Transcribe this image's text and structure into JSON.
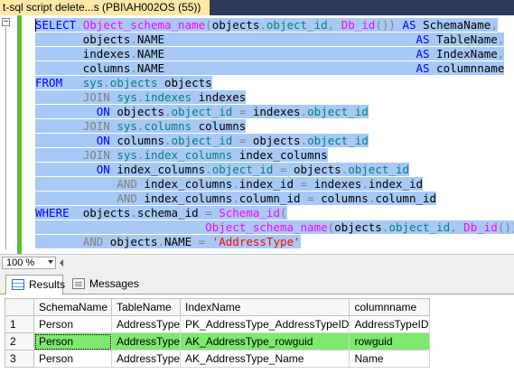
{
  "document_tab": {
    "title": "t-sql script delete...s (PBI\\AH002OS (55))"
  },
  "editor": {
    "lines": [
      [
        [
          "kw",
          "SELECT"
        ],
        [
          "tx",
          " "
        ],
        [
          "fn",
          "Object_schema_name"
        ],
        [
          "op",
          "("
        ],
        [
          "tx",
          "objects"
        ],
        [
          "op",
          "."
        ],
        [
          "id",
          "object_id"
        ],
        [
          "op",
          ", "
        ],
        [
          "fn",
          "Db_id"
        ],
        [
          "op",
          "())"
        ],
        [
          "tx",
          " "
        ],
        [
          "kw",
          "AS"
        ],
        [
          "tx",
          " SchemaName"
        ],
        [
          "op",
          ","
        ]
      ],
      [
        [
          "tx",
          "       objects"
        ],
        [
          "op",
          "."
        ],
        [
          "tx",
          "NAME                                     "
        ],
        [
          "kw",
          "AS"
        ],
        [
          "tx",
          " TableName"
        ],
        [
          "op",
          ","
        ]
      ],
      [
        [
          "tx",
          "       indexes"
        ],
        [
          "op",
          "."
        ],
        [
          "tx",
          "NAME                                     "
        ],
        [
          "kw",
          "AS"
        ],
        [
          "tx",
          " IndexName"
        ],
        [
          "op",
          ","
        ]
      ],
      [
        [
          "tx",
          "       columns"
        ],
        [
          "op",
          "."
        ],
        [
          "tx",
          "NAME                                     "
        ],
        [
          "kw",
          "AS"
        ],
        [
          "tx",
          " columnname"
        ]
      ],
      [
        [
          "kw",
          "FROM"
        ],
        [
          "tx",
          "   "
        ],
        [
          "id",
          "sys"
        ],
        [
          "op",
          "."
        ],
        [
          "id",
          "objects"
        ],
        [
          "tx",
          " objects"
        ]
      ],
      [
        [
          "tx",
          "       "
        ],
        [
          "op",
          "JOIN"
        ],
        [
          "tx",
          " "
        ],
        [
          "id",
          "sys"
        ],
        [
          "op",
          "."
        ],
        [
          "id",
          "indexes"
        ],
        [
          "tx",
          " indexes"
        ]
      ],
      [
        [
          "tx",
          "         "
        ],
        [
          "kw",
          "ON"
        ],
        [
          "tx",
          " objects"
        ],
        [
          "op",
          "."
        ],
        [
          "id",
          "object_id"
        ],
        [
          "tx",
          " "
        ],
        [
          "op",
          "="
        ],
        [
          "tx",
          " indexes"
        ],
        [
          "op",
          "."
        ],
        [
          "id",
          "object_id"
        ]
      ],
      [
        [
          "tx",
          "       "
        ],
        [
          "op",
          "JOIN"
        ],
        [
          "tx",
          " "
        ],
        [
          "id",
          "sys"
        ],
        [
          "op",
          "."
        ],
        [
          "id",
          "columns"
        ],
        [
          "tx",
          " columns"
        ]
      ],
      [
        [
          "tx",
          "         "
        ],
        [
          "kw",
          "ON"
        ],
        [
          "tx",
          " columns"
        ],
        [
          "op",
          "."
        ],
        [
          "id",
          "object_id"
        ],
        [
          "tx",
          " "
        ],
        [
          "op",
          "="
        ],
        [
          "tx",
          " objects"
        ],
        [
          "op",
          "."
        ],
        [
          "id",
          "object_id"
        ]
      ],
      [
        [
          "tx",
          "       "
        ],
        [
          "op",
          "JOIN"
        ],
        [
          "tx",
          " "
        ],
        [
          "id",
          "sys"
        ],
        [
          "op",
          "."
        ],
        [
          "id",
          "index_columns"
        ],
        [
          "tx",
          " index_columns"
        ]
      ],
      [
        [
          "tx",
          "         "
        ],
        [
          "kw",
          "ON"
        ],
        [
          "tx",
          " index_columns"
        ],
        [
          "op",
          "."
        ],
        [
          "id",
          "object_id"
        ],
        [
          "tx",
          " "
        ],
        [
          "op",
          "="
        ],
        [
          "tx",
          " objects"
        ],
        [
          "op",
          "."
        ],
        [
          "id",
          "object_id"
        ]
      ],
      [
        [
          "tx",
          "            "
        ],
        [
          "op",
          "AND"
        ],
        [
          "tx",
          " index_columns"
        ],
        [
          "op",
          "."
        ],
        [
          "tx",
          "index_id"
        ],
        [
          "tx",
          " "
        ],
        [
          "op",
          "="
        ],
        [
          "tx",
          " indexes"
        ],
        [
          "op",
          "."
        ],
        [
          "tx",
          "index_id"
        ]
      ],
      [
        [
          "tx",
          "            "
        ],
        [
          "op",
          "AND"
        ],
        [
          "tx",
          " index_columns"
        ],
        [
          "op",
          "."
        ],
        [
          "tx",
          "column_id"
        ],
        [
          "tx",
          " "
        ],
        [
          "op",
          "="
        ],
        [
          "tx",
          " columns"
        ],
        [
          "op",
          "."
        ],
        [
          "tx",
          "column_id"
        ]
      ],
      [
        [
          "kw",
          "WHERE"
        ],
        [
          "tx",
          "  objects"
        ],
        [
          "op",
          "."
        ],
        [
          "tx",
          "schema_id"
        ],
        [
          "tx",
          " "
        ],
        [
          "op",
          "="
        ],
        [
          "tx",
          " "
        ],
        [
          "fn",
          "Schema_id"
        ],
        [
          "op",
          "("
        ]
      ],
      [
        [
          "tx",
          "                         "
        ],
        [
          "fn",
          "Object_schema_name"
        ],
        [
          "op",
          "("
        ],
        [
          "tx",
          "objects"
        ],
        [
          "op",
          "."
        ],
        [
          "id",
          "object_id"
        ],
        [
          "op",
          ", "
        ],
        [
          "fn",
          "Db_id"
        ],
        [
          "op",
          "()))"
        ]
      ],
      [
        [
          "tx",
          "       "
        ],
        [
          "op",
          "AND"
        ],
        [
          "tx",
          " objects"
        ],
        [
          "op",
          "."
        ],
        [
          "tx",
          "NAME"
        ],
        [
          "tx",
          " "
        ],
        [
          "op",
          "="
        ],
        [
          "tx",
          " "
        ],
        [
          "str",
          "'AddressType'"
        ]
      ]
    ]
  },
  "status": {
    "zoom": "100 %"
  },
  "results_tabs": {
    "results_label": "Results",
    "messages_label": "Messages"
  },
  "grid": {
    "columns": [
      "SchemaName",
      "TableName",
      "IndexName",
      "columnname"
    ],
    "rows": [
      {
        "num": "1",
        "cells": [
          "Person",
          "AddressType",
          "PK_AddressType_AddressTypeID",
          "AddressTypeID"
        ]
      },
      {
        "num": "2",
        "cells": [
          "Person",
          "AddressType",
          "AK_AddressType_rowguid",
          "rowguid"
        ]
      },
      {
        "num": "3",
        "cells": [
          "Person",
          "AddressType",
          "AK_AddressType_Name",
          "Name"
        ]
      }
    ],
    "selected_row": 2,
    "selected_color": "#7ee86f"
  },
  "colors": {
    "tab_strip": "#2b3c59",
    "active_tab": "#ffe8a6",
    "selection": "#a8c9f5",
    "change_bar": "#5dbd3b",
    "keyword": "#0000ff",
    "function": "#ff00ff",
    "identifier": "#008080",
    "operator": "#808080",
    "string": "#ff0000"
  }
}
